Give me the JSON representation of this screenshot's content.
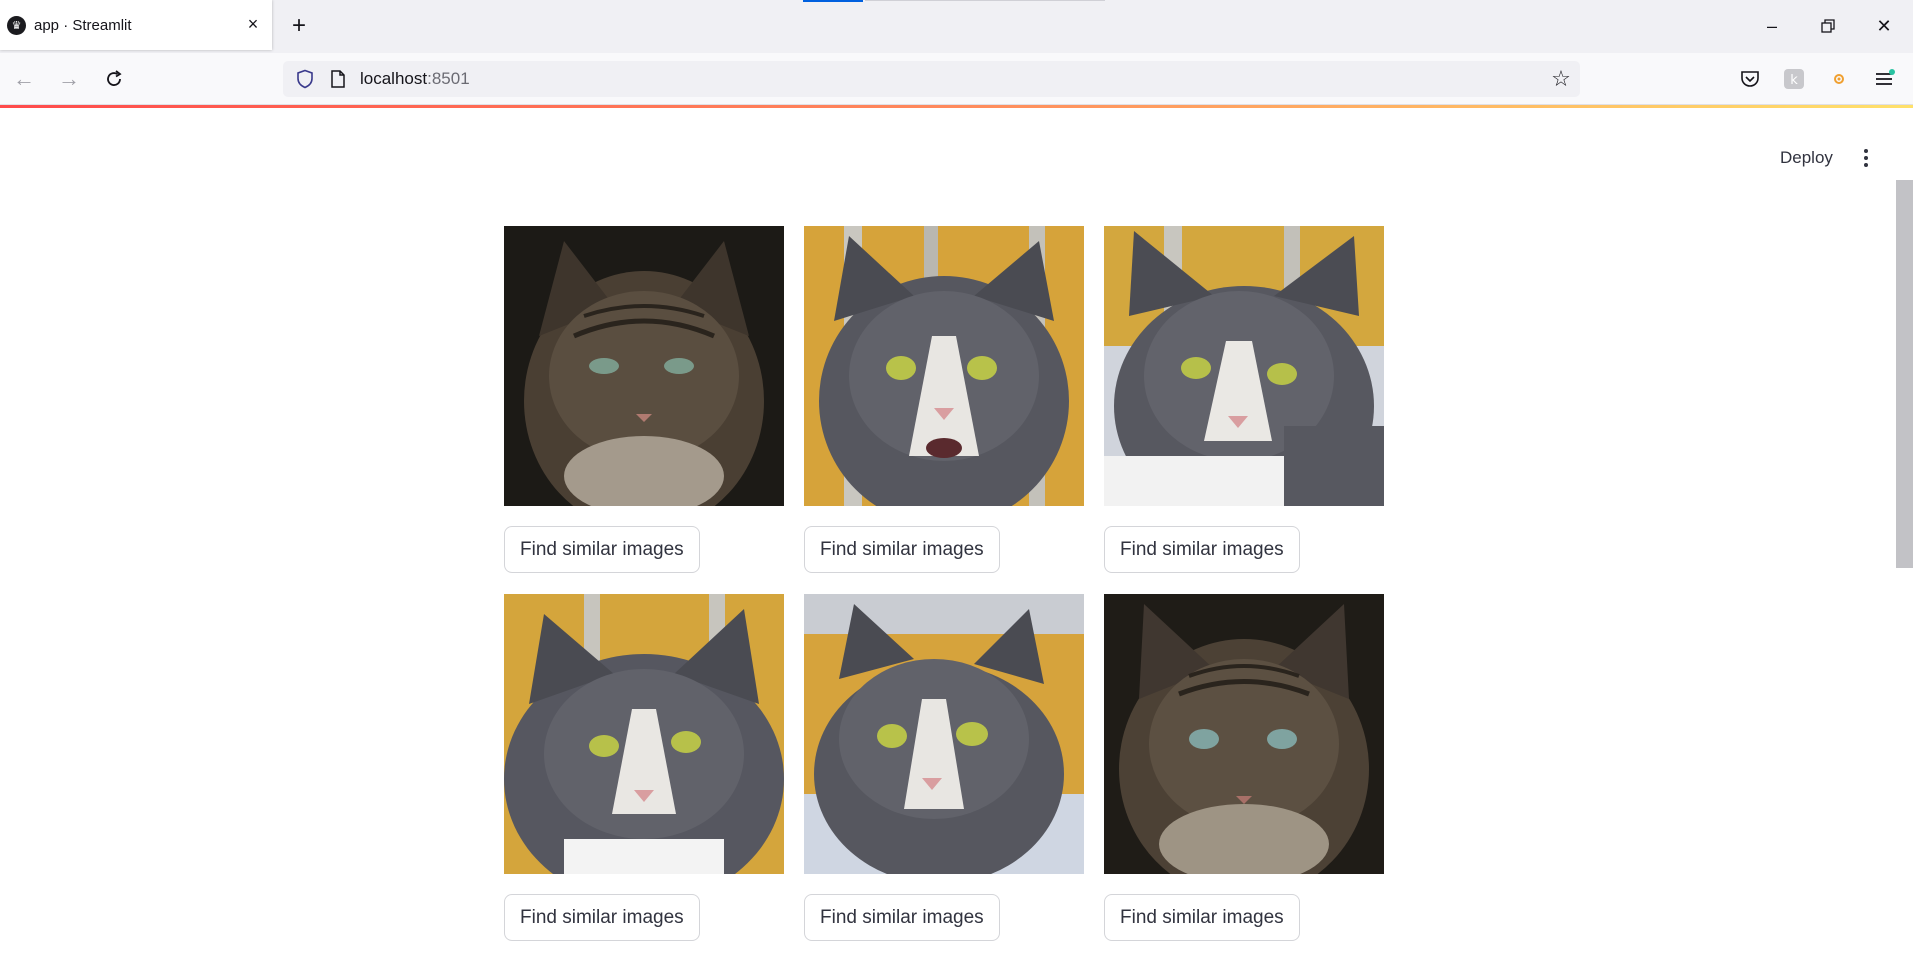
{
  "browser": {
    "tab_title": "app · Streamlit",
    "url_host": "localhost",
    "url_port": ":8501"
  },
  "app": {
    "deploy_label": "Deploy",
    "cards": [
      {
        "button_label": "Find similar images",
        "image": "tabby cat"
      },
      {
        "button_label": "Find similar images",
        "image": "gray and white cat"
      },
      {
        "button_label": "Find similar images",
        "image": "gray and white cat"
      },
      {
        "button_label": "Find similar images",
        "image": "gray and white cat"
      },
      {
        "button_label": "Find similar images",
        "image": "gray and white cat"
      },
      {
        "button_label": "Find similar images",
        "image": "tabby cat"
      }
    ]
  },
  "colors": {
    "accent_gradient_start": "#ff4b4b",
    "accent_gradient_end": "#ffe16a",
    "text": "#31333f"
  }
}
